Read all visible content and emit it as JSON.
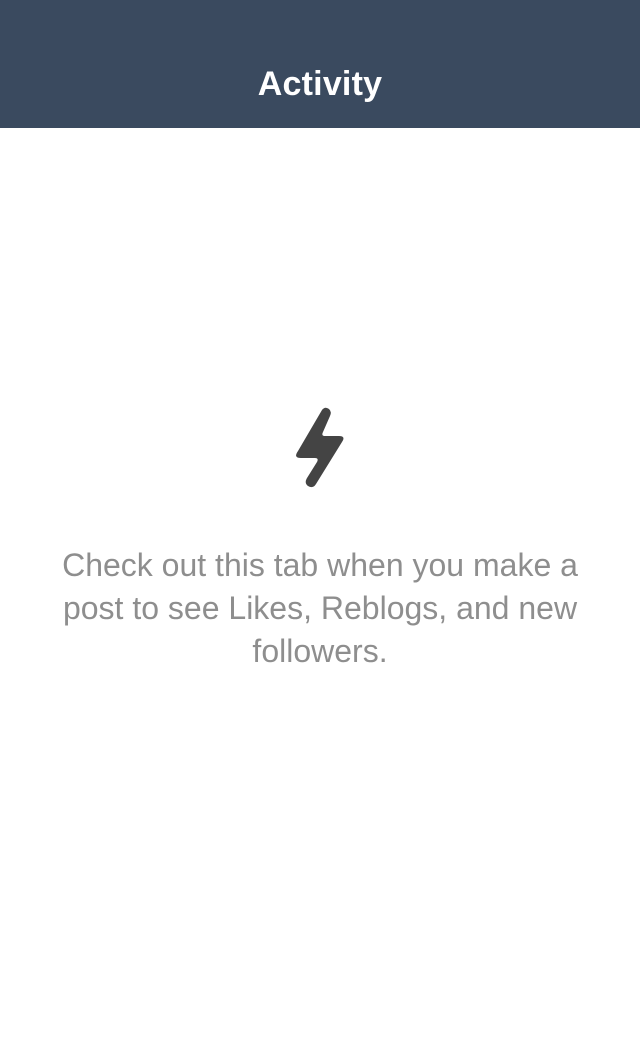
{
  "nav": {
    "title": "Activity"
  },
  "empty_state": {
    "icon": "lightning-bolt-icon",
    "message": "Check out this tab when you make a post to see Likes, Reblogs, and new followers."
  },
  "colors": {
    "nav_background": "#3a4a5f",
    "nav_title": "#ffffff",
    "icon": "#444444",
    "message_text": "#8e8e8e",
    "background": "#ffffff"
  }
}
